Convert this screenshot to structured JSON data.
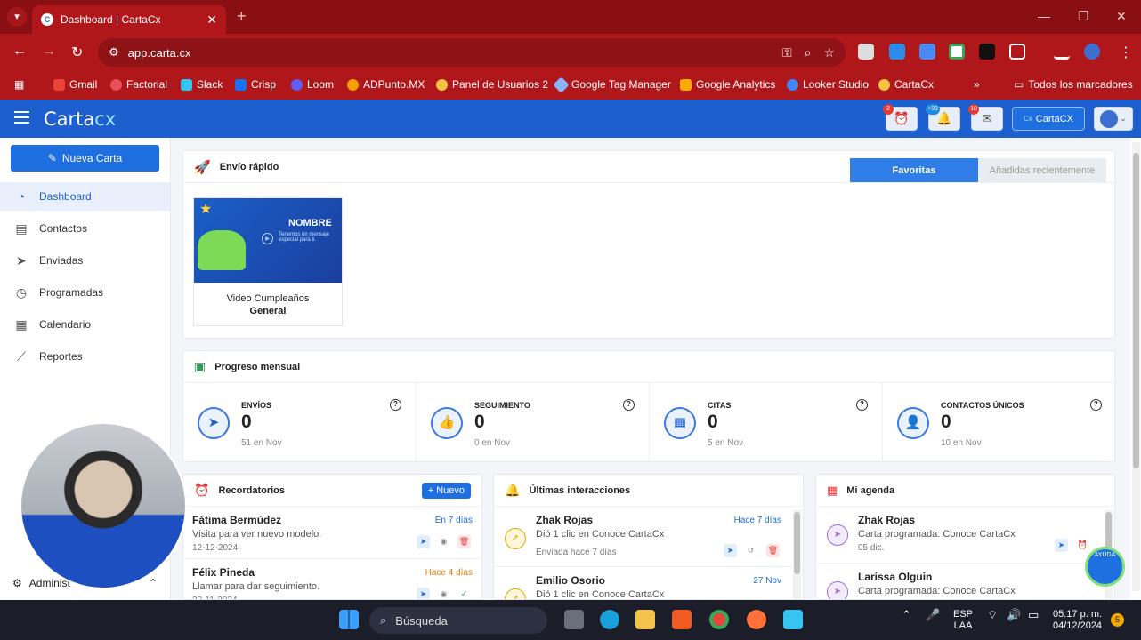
{
  "browser": {
    "tab_title": "Dashboard | CartaCx",
    "url": "app.carta.cx",
    "bookmarks": [
      {
        "label": "Gmail",
        "color": "#ea4335"
      },
      {
        "label": "Factorial",
        "color": "#e8505b"
      },
      {
        "label": "Slack",
        "color": "#4a154b"
      },
      {
        "label": "Crisp",
        "color": "#1972f5"
      },
      {
        "label": "Loom",
        "color": "#625df5"
      },
      {
        "label": "ADPunto.MX",
        "color": "#f4a000"
      },
      {
        "label": "Panel de Usuarios 2",
        "color": "#f5c542"
      },
      {
        "label": "Google Tag Manager",
        "color": "#8ab4f8"
      },
      {
        "label": "Google Analytics",
        "color": "#f9ab00"
      },
      {
        "label": "Looker Studio",
        "color": "#4285f4"
      },
      {
        "label": "CartaCx",
        "color": "#f5c542"
      }
    ],
    "all_bookmarks": "Todos los marcadores"
  },
  "app": {
    "logo_prefix": "C",
    "logo_main": "arta",
    "logo_suffix": "cx",
    "header_badges": {
      "alarm": "2",
      "reminders": "+99",
      "mail": "10"
    },
    "account_label": "CartaCX",
    "accent": "#1e5fd0"
  },
  "sidebar": {
    "new_button": "Nueva Carta",
    "items": [
      {
        "label": "Dashboard",
        "icon": "dashboard-icon"
      },
      {
        "label": "Contactos",
        "icon": "contacts-icon"
      },
      {
        "label": "Enviadas",
        "icon": "send-icon"
      },
      {
        "label": "Programadas",
        "icon": "clock-icon"
      },
      {
        "label": "Calendario",
        "icon": "calendar-icon"
      },
      {
        "label": "Reportes",
        "icon": "chart-icon"
      }
    ],
    "admin_label": "Administ"
  },
  "quick_send": {
    "title": "Envío rápido",
    "tabs": [
      "Favoritas",
      "Añadidas recientemente"
    ],
    "template": {
      "thumb_name": "NOMBRE",
      "thumb_text": "Tenemos un mensaje especial para ti.",
      "title_line1": "Video Cumpleaños",
      "title_line2": "General"
    }
  },
  "monthly": {
    "title": "Progreso mensual",
    "stats": [
      {
        "label": "ENVÍOS",
        "value": "0",
        "sub": "51 en Nov",
        "icon": "send-icon"
      },
      {
        "label": "SEGUIMIENTO",
        "value": "0",
        "sub": "0 en Nov",
        "icon": "thumbs-up-icon"
      },
      {
        "label": "CITAS",
        "value": "0",
        "sub": "5 en Nov",
        "icon": "calendar-check-icon"
      },
      {
        "label": "CONTACTOS ÚNICOS",
        "value": "0",
        "sub": "10 en Nov",
        "icon": "user-plus-icon"
      }
    ]
  },
  "reminders": {
    "title": "Recordatorios",
    "new_button": "Nuevo",
    "items": [
      {
        "name": "Fátima Bermúdez",
        "desc": "Visita para ver nuevo modelo.",
        "date": "12-12-2024",
        "when": "En 7 días",
        "when_color": "#1e6fe0"
      },
      {
        "name": "Félix Pineda",
        "desc": "Llamar para dar seguimiento.",
        "date": "30-11-2024",
        "when": "Hace 4 días",
        "when_color": "#e67e00"
      }
    ]
  },
  "interactions": {
    "title": "Últimas interacciones",
    "items": [
      {
        "name": "Zhak Rojas",
        "desc": "Dió 1 clic en Conoce CartaCx",
        "small": "Enviada hace 7 días",
        "when": "Hace 7 días"
      },
      {
        "name": "Emilio Osorio",
        "desc": "Dió 1 clic en Conoce CartaCx",
        "small": "",
        "when": "27 Nov"
      }
    ]
  },
  "agenda": {
    "title": "Mi agenda",
    "items": [
      {
        "name": "Zhak Rojas",
        "desc": "Carta programada: Conoce CartaCx",
        "small": "05 dic."
      },
      {
        "name": "Larissa Olguin",
        "desc": "Carta programada: Conoce CartaCx",
        "small": ""
      }
    ]
  },
  "help_bubble": "AYUDA",
  "taskbar": {
    "search": "Búsqueda",
    "lang1": "ESP",
    "lang2": "LAA",
    "time": "05:17 p. m.",
    "date": "04/12/2024",
    "notif": "5"
  }
}
